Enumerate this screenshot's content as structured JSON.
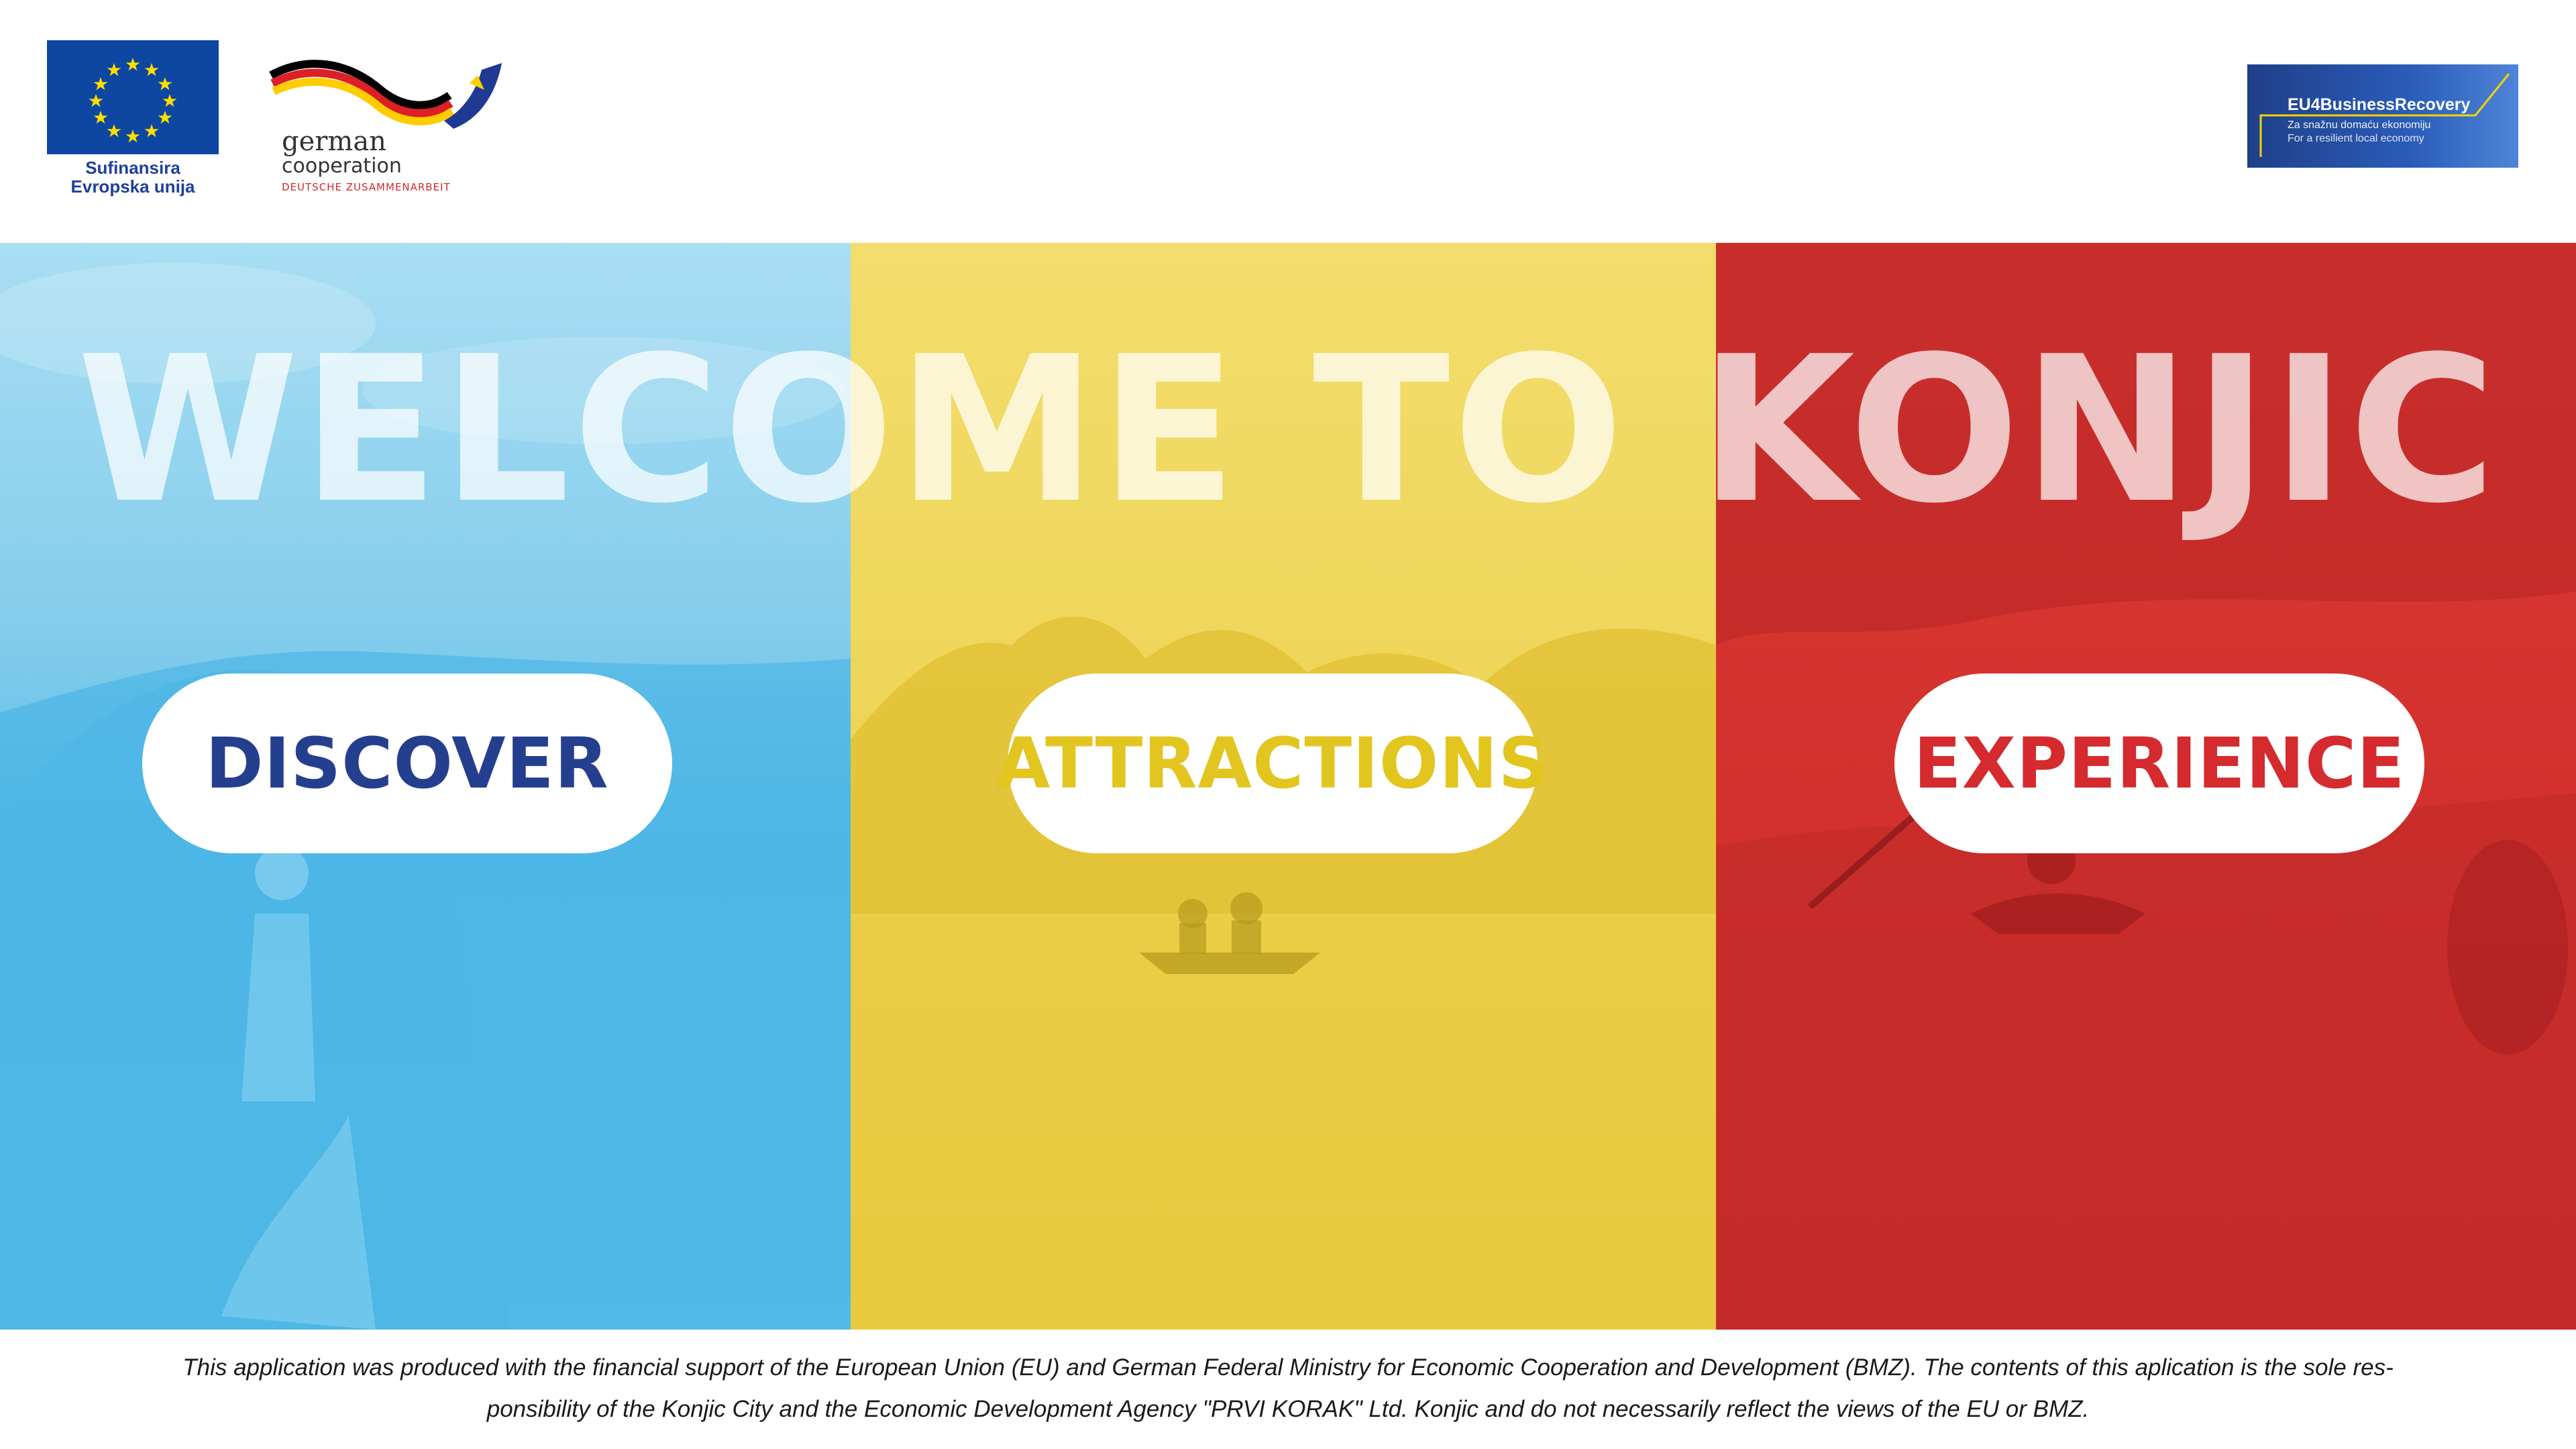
{
  "header": {
    "eu_logo": {
      "caption_line1": "Sufinansira",
      "caption_line2": "Evropska unija",
      "flag_color": "#0e47a1",
      "star_color": "#ffdd00"
    },
    "german_cooperation_logo": {
      "line1": "german",
      "line2": "cooperation",
      "line3": "DEUTSCHE ZUSAMMENARBEIT"
    },
    "eu4_logo": {
      "title": "EU4BusinessRecovery",
      "subtitle1": "Za snažnu domaću ekonomiju",
      "subtitle2": "For a resilient local economy"
    }
  },
  "hero": {
    "title": "WELCOME TO KONJIC",
    "panels": [
      {
        "label": "DISCOVER",
        "color": "#5cbde8",
        "text_color": "#253f8f"
      },
      {
        "label": "ATTRACTIONS",
        "color": "#eed65a",
        "text_color": "#e2c51f"
      },
      {
        "label": "EXPERIENCE",
        "color": "#d3312d",
        "text_color": "#d52a2e"
      }
    ]
  },
  "footer": {
    "disclaimer_line1": "This application was produced with the financial support of the European Union (EU) and  German Federal Ministry for Economic Cooperation and Development (BMZ). The contents of this aplication is the sole res-",
    "disclaimer_line2": "ponsibility of the Konjic City and the Economic Development Agency \"PRVI KORAK\" Ltd. Konjic and do not necessarily reflect the views of the EU or BMZ."
  }
}
